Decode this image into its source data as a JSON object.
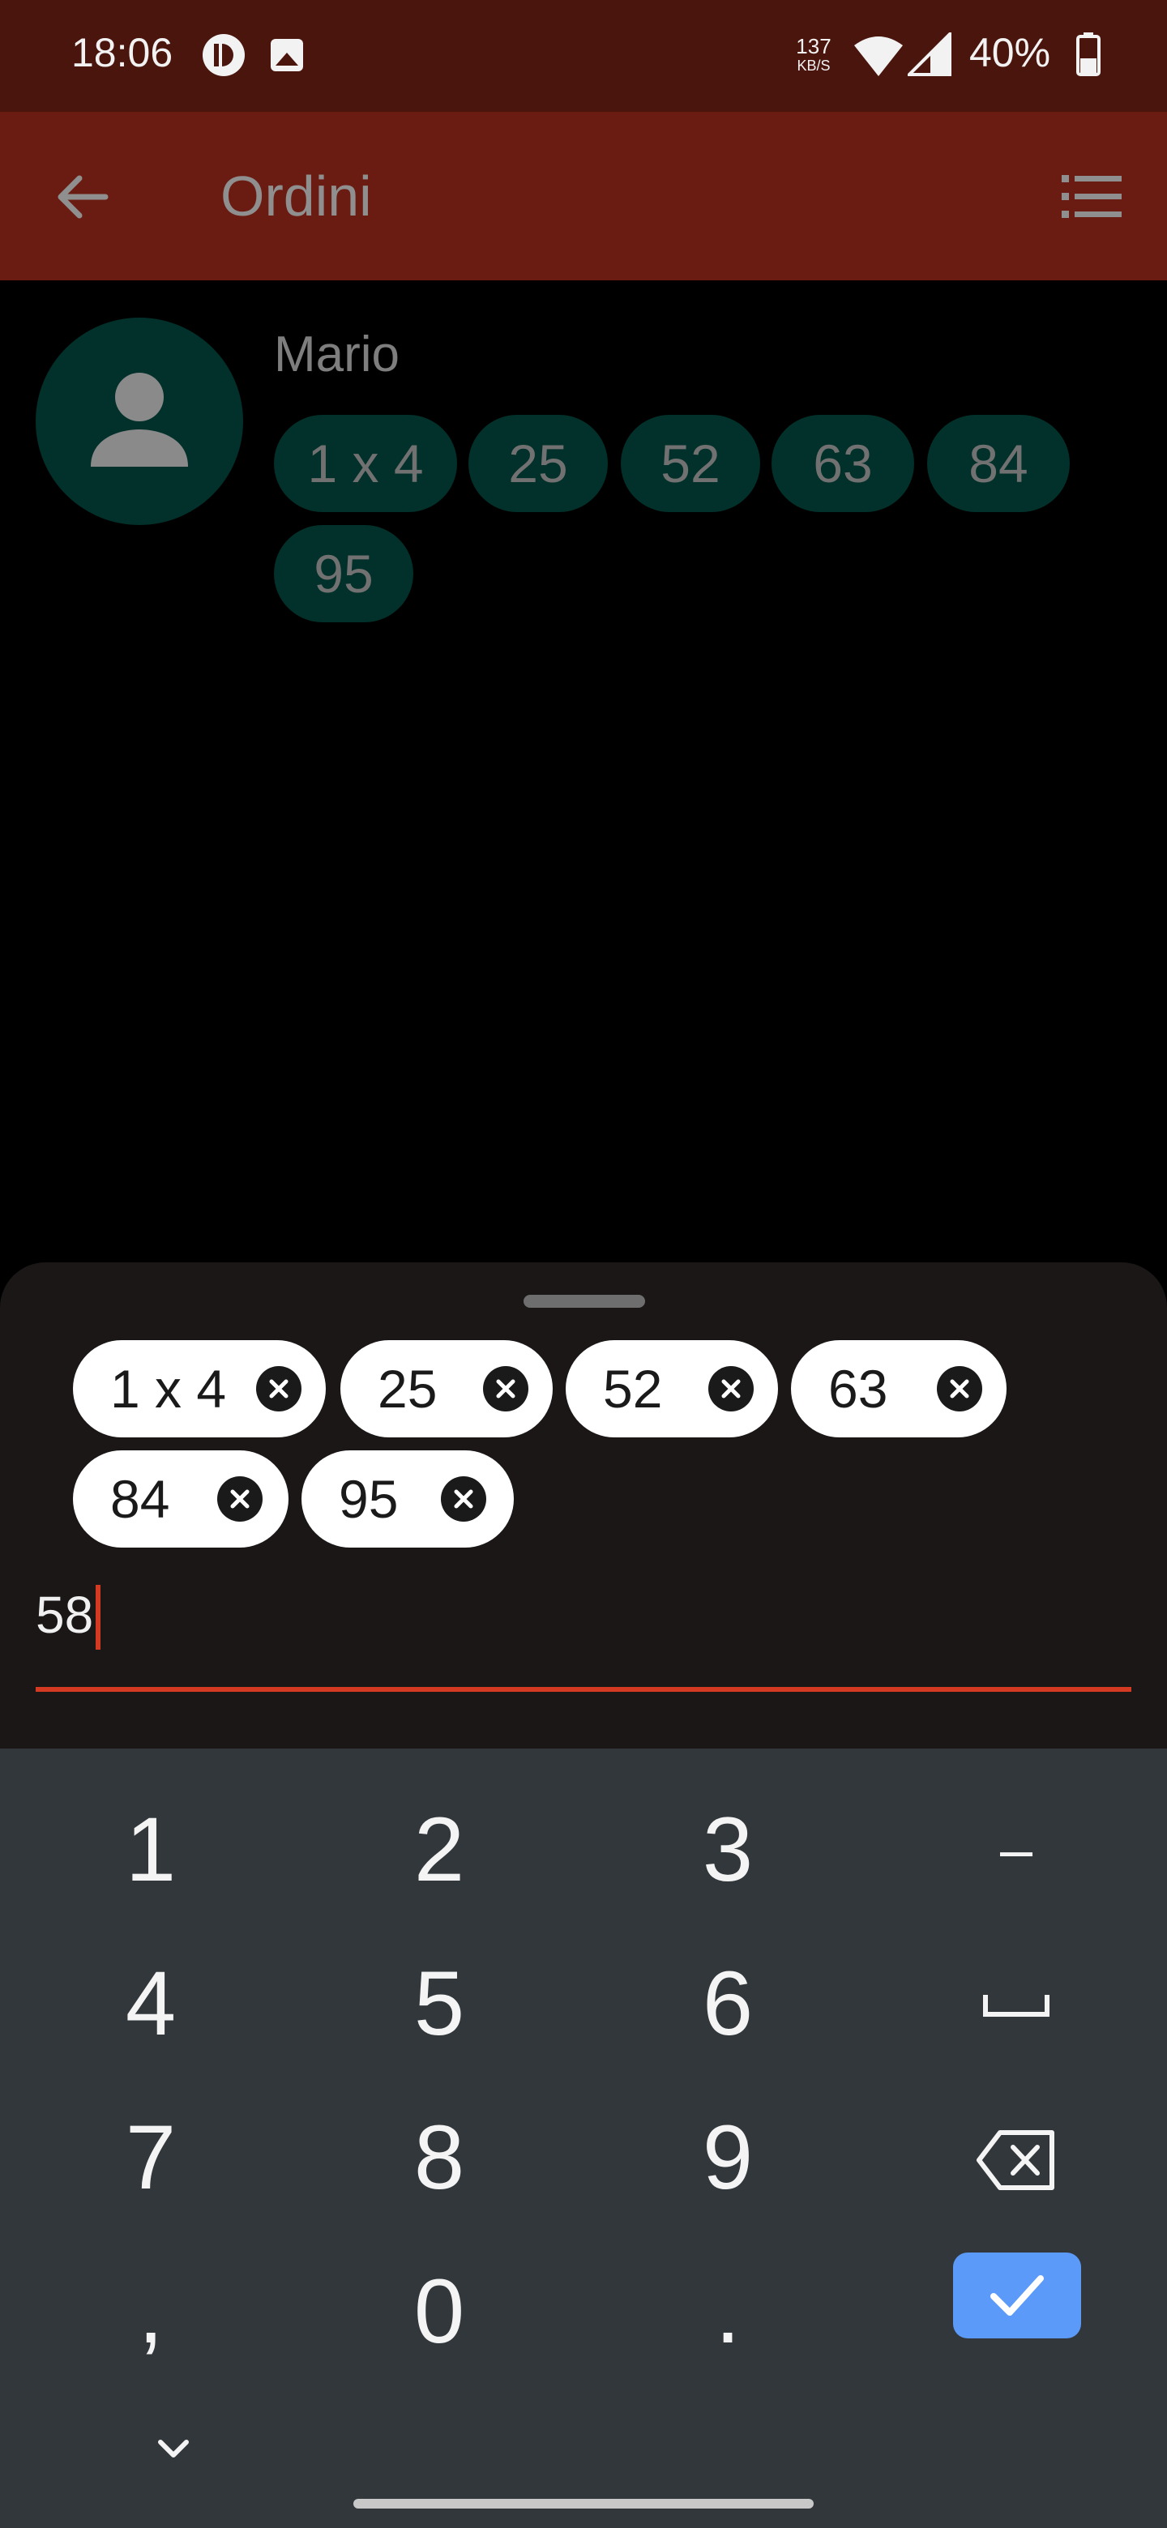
{
  "status_bar": {
    "time": "18:06",
    "net_speed_value": "137",
    "net_speed_unit": "KB/S",
    "battery": "40%",
    "icons": [
      "notification-app-icon",
      "image-icon",
      "wifi-icon",
      "signal-icon",
      "battery-icon"
    ]
  },
  "app_bar": {
    "title": "Ordini",
    "back_icon": "arrow-back-icon",
    "menu_icon": "list-icon"
  },
  "contact": {
    "name": "Mario",
    "avatar_icon": "person-icon",
    "chips": [
      "1 x 4",
      "25",
      "52",
      "63",
      "84",
      "95"
    ]
  },
  "sheet": {
    "chips": [
      "1 x 4",
      "25",
      "52",
      "63",
      "84",
      "95"
    ],
    "input_value": "58"
  },
  "keyboard": {
    "rows": [
      [
        "1",
        "2",
        "3",
        "–"
      ],
      [
        "4",
        "5",
        "6",
        "space"
      ],
      [
        "7",
        "8",
        "9",
        "backspace"
      ],
      [
        ",",
        "0",
        ".",
        "done"
      ]
    ],
    "keys": {
      "k1": "1",
      "k2": "2",
      "k3": "3",
      "dash": "–",
      "k4": "4",
      "k5": "5",
      "k6": "6",
      "k7": "7",
      "k8": "8",
      "k9": "9",
      "comma": ",",
      "k0": "0",
      "period": "."
    }
  },
  "colors": {
    "status_bar": "#4a150d",
    "app_bar": "#6b1c12",
    "accent": "#d43a22",
    "chip_dark": "#02302a",
    "done_key": "#5b9af8"
  }
}
